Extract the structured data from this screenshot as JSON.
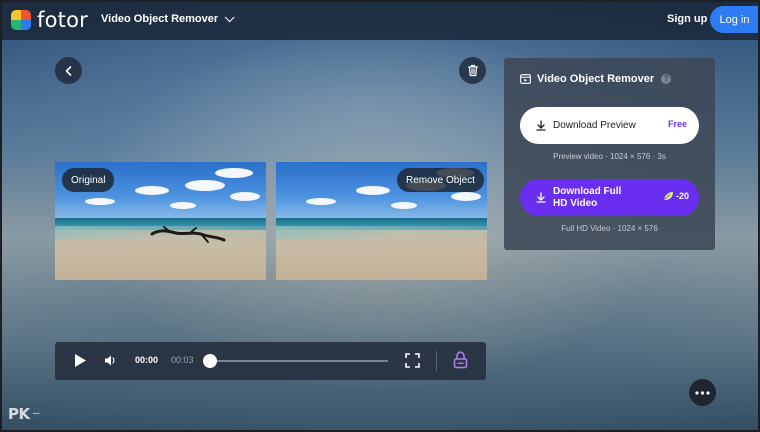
{
  "header": {
    "logo_text": "fotor",
    "tool_menu_label": "Video Object Remover",
    "signup_label": "Sign up",
    "login_label": "Log in"
  },
  "colors": {
    "accent_blue": "#2d7cf3",
    "accent_purple": "#6a2ef0",
    "free_text": "#6b35e8",
    "lock_icon": "#b07cf0"
  },
  "preview": {
    "original_label": "Original",
    "removed_label": "Remove Object"
  },
  "panel": {
    "title": "Video Object Remover",
    "help_glyph": "?",
    "download_preview_label": "Download Preview",
    "free_badge": "Free",
    "preview_meta": "Preview video · 1024 × 576 · 3s",
    "download_hd_label": "Download Full HD Video",
    "hd_cost": "-20",
    "hd_meta": "Full HD Video · 1024 × 576"
  },
  "player": {
    "current_time": "00:00",
    "duration": "00:03",
    "progress": 0
  },
  "watermark": {
    "text": "PK"
  },
  "icons": [
    "back-icon",
    "trash-icon",
    "help-icon",
    "download-icon",
    "leaf-icon",
    "play-icon",
    "volume-icon",
    "fullscreen-icon",
    "lock-icon",
    "more-icon",
    "chevron-down-icon",
    "panel-video-icon"
  ]
}
